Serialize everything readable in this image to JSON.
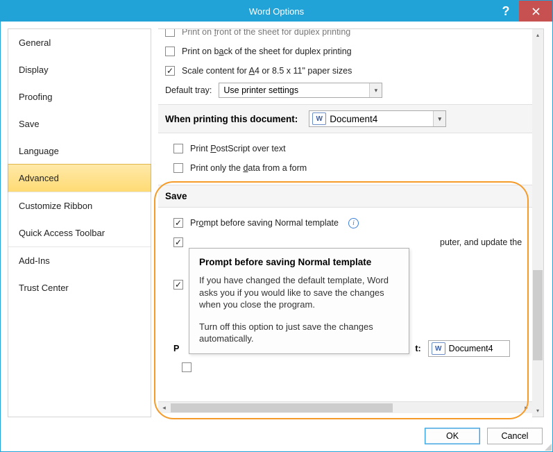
{
  "window": {
    "title": "Word Options"
  },
  "sidebar": {
    "items": [
      {
        "label": "General"
      },
      {
        "label": "Display"
      },
      {
        "label": "Proofing"
      },
      {
        "label": "Save"
      },
      {
        "label": "Language"
      },
      {
        "label": "Advanced",
        "selected": true
      },
      {
        "label": "Customize Ribbon"
      },
      {
        "label": "Quick Access Toolbar"
      },
      {
        "label": "Add-Ins"
      },
      {
        "label": "Trust Center"
      }
    ]
  },
  "print": {
    "front_cut": "Print on front of the sheet for duplex printing",
    "back": "Print on back of the sheet for duplex printing",
    "scale": "Scale content for A4 or 8.5 x 11\" paper sizes",
    "default_tray_label": "Default tray:",
    "default_tray_value": "Use printer settings"
  },
  "when_printing": {
    "header": "When printing this document:",
    "doc": "Document4",
    "postscript": "Print PostScript over text",
    "data_only": "Print only the data from a form"
  },
  "save": {
    "header": "Save",
    "prompt": "Prompt before saving Normal template",
    "partial1": "puter, and update the"
  },
  "preserve": {
    "header_start": "P",
    "header_end": "t:",
    "doc": "Document4"
  },
  "tooltip": {
    "title": "Prompt before saving Normal template",
    "p1": "If you have changed the default template, Word asks you if you would like to save the changes when you close the program.",
    "p2": "Turn off this option to just save the changes automatically."
  },
  "footer": {
    "ok": "OK",
    "cancel": "Cancel"
  }
}
